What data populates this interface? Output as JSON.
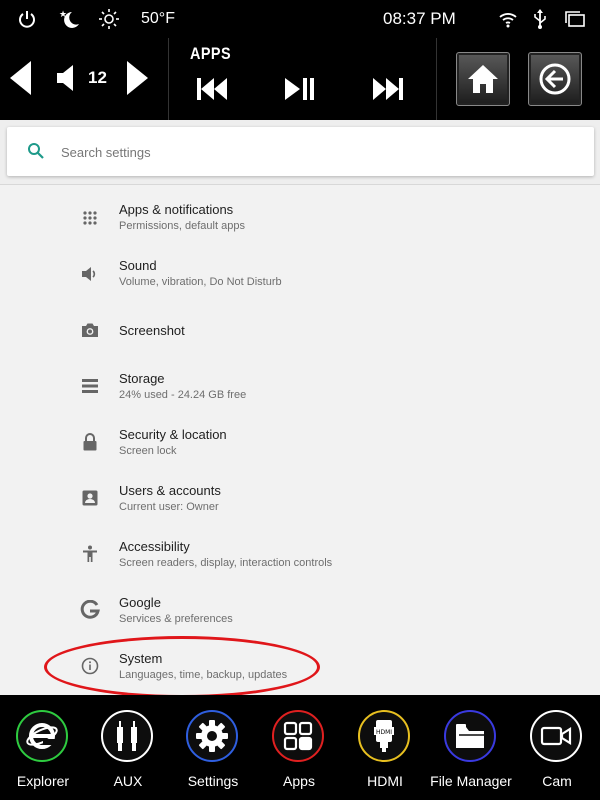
{
  "status_bar": {
    "temperature": "50°F",
    "time": "08:37 PM"
  },
  "control_bar": {
    "volume_level": "12",
    "mode_label": "APPS"
  },
  "search": {
    "placeholder": "Search settings"
  },
  "settings_items": [
    {
      "title": "Apps & notifications",
      "subtitle": "Permissions, default apps",
      "icon": "apps-grid-icon"
    },
    {
      "title": "Sound",
      "subtitle": "Volume, vibration, Do Not Disturb",
      "icon": "speaker-icon"
    },
    {
      "title": "Screenshot",
      "subtitle": "",
      "icon": "camera-icon"
    },
    {
      "title": "Storage",
      "subtitle": "24% used - 24.24 GB free",
      "icon": "storage-icon"
    },
    {
      "title": "Security & location",
      "subtitle": "Screen lock",
      "icon": "lock-icon"
    },
    {
      "title": "Users & accounts",
      "subtitle": "Current user: Owner",
      "icon": "account-icon"
    },
    {
      "title": "Accessibility",
      "subtitle": "Screen readers, display, interaction controls",
      "icon": "accessibility-icon"
    },
    {
      "title": "Google",
      "subtitle": "Services & preferences",
      "icon": "google-icon"
    },
    {
      "title": "System",
      "subtitle": "Languages, time, backup, updates",
      "icon": "info-icon"
    }
  ],
  "dock": [
    {
      "label": "Explorer",
      "icon": "explorer-icon",
      "ring_color": "#2ecc40"
    },
    {
      "label": "AUX",
      "icon": "aux-icon",
      "ring_color": "#ffffff"
    },
    {
      "label": "Settings",
      "icon": "settings-gear-icon",
      "ring_color": "#2f5fe0"
    },
    {
      "label": "Apps",
      "icon": "apps-icon",
      "ring_color": "#e02020"
    },
    {
      "label": "HDMI",
      "icon": "hdmi-icon",
      "ring_color": "#e8c020"
    },
    {
      "label": "File Manager",
      "icon": "folder-icon",
      "ring_color": "#3a3ae0"
    },
    {
      "label": "Cam",
      "icon": "camera-icon",
      "ring_color": "#ffffff"
    }
  ],
  "colors": {
    "highlight_ellipse": "#e0161a",
    "search_icon": "#1e9a8a"
  }
}
